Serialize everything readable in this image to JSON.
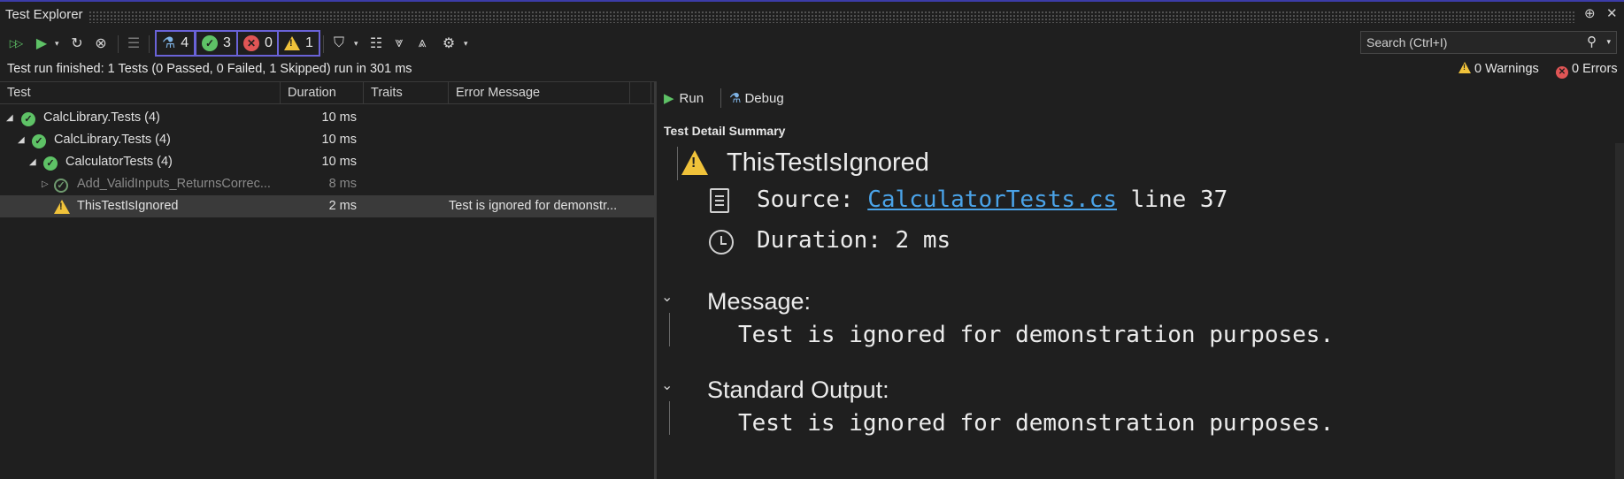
{
  "window": {
    "title": "Test Explorer",
    "pin_glyph": "⊕",
    "close_glyph": "✕"
  },
  "toolbar": {
    "run_all_glyph": "▷▷",
    "run_glyph": "▶",
    "caret_glyph": "▾",
    "repeat_glyph": "↻",
    "cancel_glyph": "⊗",
    "playlist_glyph": "☰",
    "counts": {
      "total": "4",
      "passed": "3",
      "failed": "0",
      "skipped": "1"
    },
    "group_glyph": "⛉",
    "columns_glyph": "☷",
    "expand_glyph": "⩔",
    "collapse_glyph": "⩓",
    "settings_glyph": "⚙",
    "search_placeholder": "Search (Ctrl+I)",
    "search_glyph": "⚲"
  },
  "status": {
    "message": "Test run finished: 1 Tests (0 Passed, 0 Failed, 1 Skipped) run in 301 ms",
    "warnings": "0 Warnings",
    "errors": "0 Errors"
  },
  "columns": [
    "Test",
    "Duration",
    "Traits",
    "Error Message"
  ],
  "tree": [
    {
      "name": "CalcLibrary.Tests  (4)",
      "duration": "10 ms",
      "error": "",
      "status": "passed",
      "dim": false
    },
    {
      "name": "CalcLibrary.Tests  (4)",
      "duration": "10 ms",
      "error": "",
      "status": "passed",
      "dim": false
    },
    {
      "name": "CalculatorTests  (4)",
      "duration": "10 ms",
      "error": "",
      "status": "passed",
      "dim": false
    },
    {
      "name": "Add_ValidInputs_ReturnsCorrec...",
      "duration": "8 ms",
      "error": "",
      "status": "passed-dim",
      "dim": true
    },
    {
      "name": "ThisTestIsIgnored",
      "duration": "2 ms",
      "error": "Test is ignored for demonstr...",
      "status": "skipped",
      "dim": false
    }
  ],
  "detail": {
    "run_label": "Run",
    "debug_label": "Debug",
    "summary_heading": "Test Detail Summary",
    "test_name": "ThisTestIsIgnored",
    "source_label": "Source:",
    "source_file": "CalculatorTests.cs",
    "source_line": "line 37",
    "duration_label": "Duration:",
    "duration_value": "2 ms",
    "message_heading": "Message:",
    "message_text": "Test is ignored for demonstration purposes.",
    "output_heading": "Standard Output:",
    "output_text": "Test is ignored for demonstration purposes."
  },
  "colors": {
    "background": "#1f1f1f",
    "pass": "#5ec266",
    "fail": "#e05555",
    "warn": "#f0c23a",
    "accent": "#6a63d8",
    "link": "#4aa3e8"
  }
}
